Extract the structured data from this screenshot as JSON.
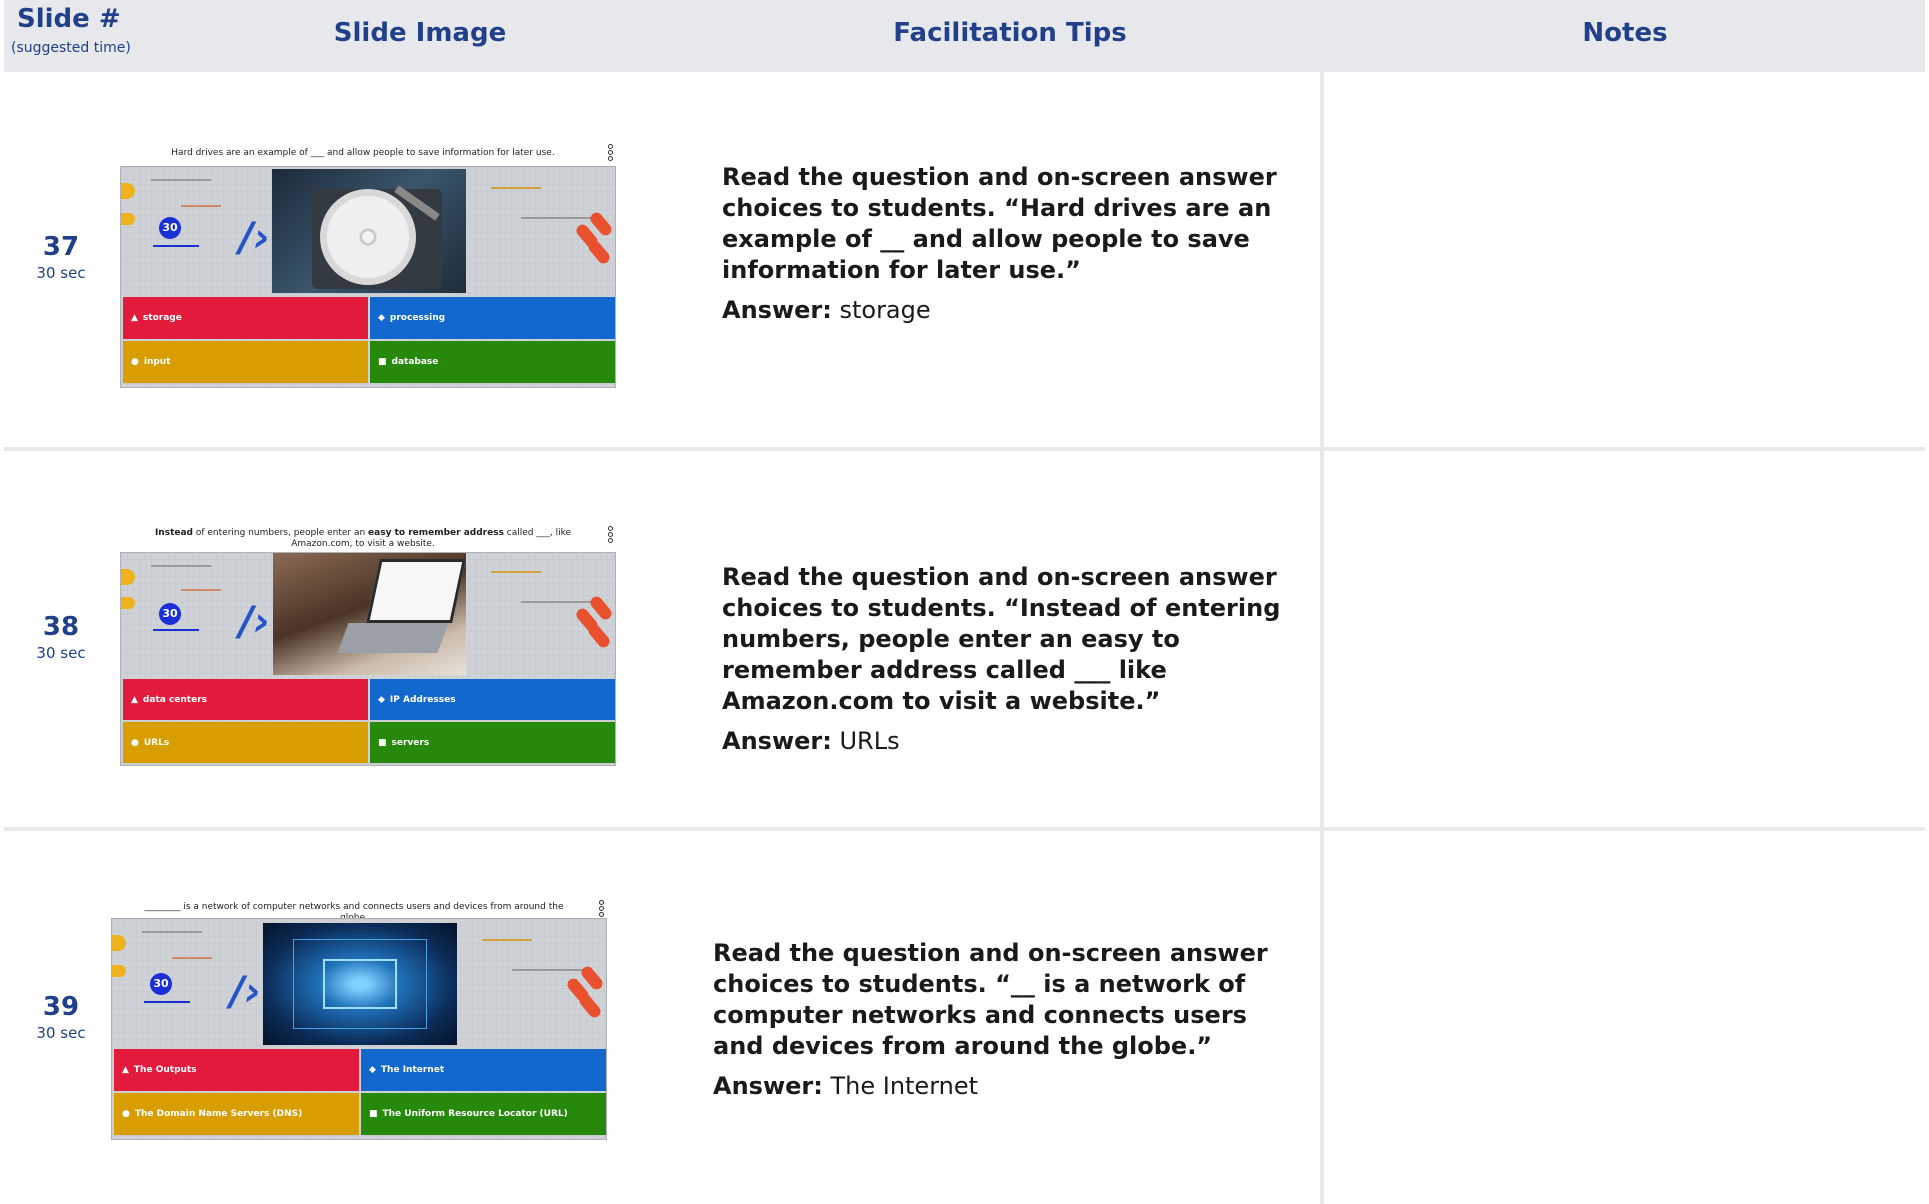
{
  "header": {
    "slide_label": "Slide #",
    "slide_sublabel": "(suggested time)",
    "image_label": "Slide Image",
    "tips_label": "Facilitation Tips",
    "notes_label": "Notes"
  },
  "rows": [
    {
      "number": "37",
      "time": "30 sec",
      "tip_question": "Read the question and on-screen answer choices to students. “Hard drives are an example of __ and allow people to save information for later use.”",
      "answer_label": "Answer:",
      "answer_value": "storage",
      "slide": {
        "question": "Hard drives are an example of ___ and allow people to save information for later use.",
        "timer": "30",
        "image": "hard-drive-photo",
        "answers": [
          "storage",
          "processing",
          "input",
          "database"
        ]
      }
    },
    {
      "number": "38",
      "time": "30 sec",
      "tip_question": "Read the question and on-screen answer choices to students. “Instead of entering numbers, people enter an easy to remember address called ___ like Amazon.com to visit a website.”",
      "answer_label": "Answer:",
      "answer_value": "URLs",
      "slide": {
        "question_html_parts": [
          "Instead",
          " of entering numbers, people enter an ",
          "easy to remember address",
          " called ___, like Amazon.com, to visit a website."
        ],
        "timer": "30",
        "image": "laptop-photo",
        "answers": [
          "data centers",
          "IP Addresses",
          "URLs",
          "servers"
        ]
      }
    },
    {
      "number": "39",
      "time": "30 sec",
      "tip_question": "Read the question and on-screen answer choices to students. “__ is a network of computer networks and connects users and devices from around the globe.”",
      "answer_label": "Answer:",
      "answer_value": "The Internet",
      "slide": {
        "question": "________ is a network of computer networks and connects users and devices from around the globe.",
        "timer": "30",
        "image": "data-center-photo",
        "answers": [
          "The Outputs",
          "The Internet",
          "The Domain Name Servers (DNS)",
          "The Uniform Resource Locator (URL)"
        ]
      }
    }
  ],
  "colors": {
    "header_bg": "#e6e8eb",
    "header_text": "#22408a",
    "answer_red": "#e21b3c",
    "answer_blue": "#1368ce",
    "answer_gold": "#d89e00",
    "answer_green": "#26890c",
    "timer": "#1a2fd6"
  },
  "icons": {
    "answer_1": "triangle-icon",
    "answer_2": "diamond-icon",
    "answer_3": "circle-icon",
    "answer_4": "square-icon",
    "menu": "kebab-menu-icon"
  }
}
